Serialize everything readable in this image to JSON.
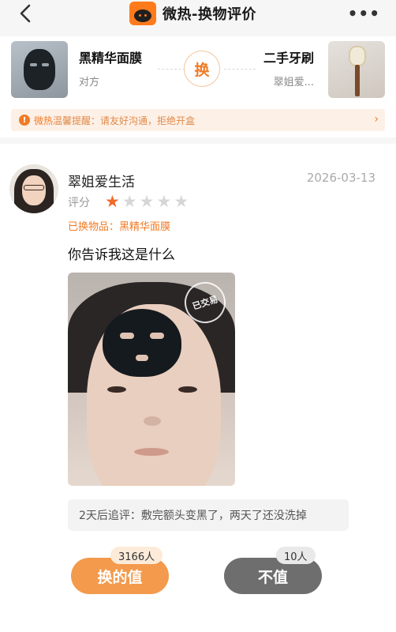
{
  "header": {
    "title": "微热-换物评价",
    "back_icon": "chevron-left-icon",
    "more_icon": "more-dots-icon",
    "more_glyph": "•••"
  },
  "swap": {
    "left": {
      "name": "黑精华面膜",
      "owner": "对方"
    },
    "right": {
      "name": "二手牙刷",
      "owner": "翠姐爱..."
    },
    "swap_label": "换",
    "tip": {
      "brand": "微热",
      "text": "温馨提醒：请友好沟通，拒绝开盒"
    }
  },
  "review": {
    "username": "翠姐爱生活",
    "date": "2026-03-13",
    "rating_label": "评分",
    "rating": 1,
    "rating_max": 5,
    "traded_label": "已换物品：",
    "traded_item": "黑精华面膜",
    "comment": "你告诉我这是什么",
    "photo_stamp": "已交易",
    "followup": "2天后追评：敷完额头变黑了，两天了还没洗掉"
  },
  "votes": {
    "worth": {
      "label": "换的值",
      "count": "3166人"
    },
    "not_worth": {
      "label": "不值",
      "count": "10人"
    }
  },
  "colors": {
    "accent": "#f07b26",
    "worth_button": "#f39a4c",
    "not_worth_button": "#6e6e6e",
    "star_on": "#f06a2a",
    "star_off": "#d6d6d6"
  }
}
